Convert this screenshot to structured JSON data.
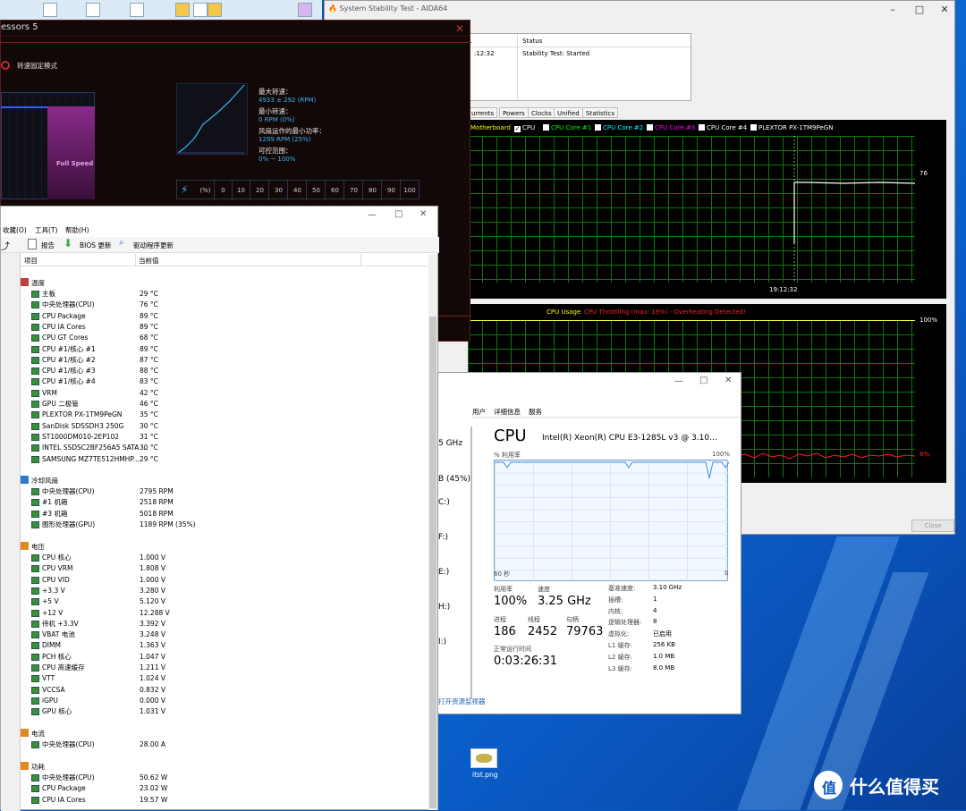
{
  "fan_tool": {
    "title": "essors 5",
    "mode_label": "转速固定模式",
    "full_speed": "Full Speed",
    "max_label": "最大转速：",
    "max_value": "4933 ± 292 (RPM)",
    "min_label": "最小转速：",
    "min_value": "0 RPM (0%)",
    "min_power_label": "风扇运作的最小功率：",
    "min_power_value": "1299 RPM (25%)",
    "range_label": "可控范围：",
    "range_value": "0% ~ 100%",
    "speed_header": [
      "(%)",
      "0",
      "10",
      "20",
      "30",
      "40",
      "50",
      "60",
      "70",
      "80",
      "90",
      "100"
    ]
  },
  "stability": {
    "title": "System Stability Test - AIDA64",
    "table_headers": [
      "",
      "Status"
    ],
    "table_row": {
      "time": ":12:32",
      "status": "Stability Test: Started"
    },
    "tabs": [
      "urrents",
      "Powers",
      "Clocks",
      "Unified",
      "Statistics"
    ],
    "legend": [
      {
        "label": "Motherboard",
        "color": "#ffff00",
        "checked": false
      },
      {
        "label": "CPU",
        "color": "#ffffff",
        "checked": true
      },
      {
        "label": "CPU Core #1",
        "color": "#00ff00",
        "checked": false
      },
      {
        "label": "CPU Core #2",
        "color": "#00ffff",
        "checked": false
      },
      {
        "label": "CPU Core #3",
        "color": "#ff00ff",
        "checked": false
      },
      {
        "label": "CPU Core #4",
        "color": "#ffffff",
        "checked": false
      },
      {
        "label": "PLEXTOR PX-1TM9PeGN",
        "color": "#ffffff",
        "checked": false
      }
    ],
    "temp_value": "76",
    "time_label": "19:12:32",
    "usage_label": "CPU Usage",
    "throttle_label": "CPU Throttling (max: 19%) - Overheating Detected!",
    "usage_max": "100%",
    "usage_val": "8%",
    "close_label": "Close"
  },
  "sensors": {
    "menu": [
      "收藏(O)",
      "工具(T)",
      "帮助(H)"
    ],
    "toolbar": {
      "report": "报告",
      "bios": "BIOS 更新",
      "driver": "驱动程序更新"
    },
    "col_item": "项目",
    "col_value": "当前值",
    "temperature": {
      "title": "温度",
      "rows": [
        [
          "主板",
          "29 °C"
        ],
        [
          "中央处理器(CPU)",
          "76 °C"
        ],
        [
          "CPU Package",
          "89 °C"
        ],
        [
          "CPU IA Cores",
          "89 °C"
        ],
        [
          "CPU GT Cores",
          "68 °C"
        ],
        [
          "CPU #1/核心 #1",
          "89 °C"
        ],
        [
          "CPU #1/核心 #2",
          "87 °C"
        ],
        [
          "CPU #1/核心 #3",
          "88 °C"
        ],
        [
          "CPU #1/核心 #4",
          "83 °C"
        ],
        [
          "VRM",
          "42 °C"
        ],
        [
          "GPU 二极管",
          "46 °C"
        ],
        [
          "PLEXTOR PX-1TM9PeGN",
          "35 °C"
        ],
        [
          "SanDisk SDSSDH3 250G",
          "30 °C"
        ],
        [
          "ST1000DM010-2EP102",
          "31 °C"
        ],
        [
          "INTEL SSDSC2BF256A5 SATA ...",
          "30 °C"
        ],
        [
          "SAMSUNG MZ7TE512HMHP...",
          "29 °C"
        ]
      ]
    },
    "fans": {
      "title": "冷却风扇",
      "rows": [
        [
          "中央处理器(CPU)",
          "2795 RPM"
        ],
        [
          "#1 机箱",
          "2518 RPM"
        ],
        [
          "#3 机箱",
          "5018 RPM"
        ],
        [
          "图形处理器(GPU)",
          "1189 RPM  (35%)"
        ]
      ]
    },
    "voltage": {
      "title": "电压",
      "rows": [
        [
          "CPU 核心",
          "1.000 V"
        ],
        [
          "CPU VRM",
          "1.808 V"
        ],
        [
          "CPU VID",
          "1.000 V"
        ],
        [
          "+3.3 V",
          "3.280 V"
        ],
        [
          "+5 V",
          "5.120 V"
        ],
        [
          "+12 V",
          "12.288 V"
        ],
        [
          "待机 +3.3V",
          "3.392 V"
        ],
        [
          "VBAT 电池",
          "3.248 V"
        ],
        [
          "DIMM",
          "1.363 V"
        ],
        [
          "PCH 核心",
          "1.047 V"
        ],
        [
          "CPU 高速缓存",
          "1.211 V"
        ],
        [
          "VTT",
          "1.024 V"
        ],
        [
          "VCCSA",
          "0.832 V"
        ],
        [
          "iGPU",
          "0.000 V"
        ],
        [
          "GPU 核心",
          "1.031 V"
        ]
      ]
    },
    "current": {
      "title": "电流",
      "rows": [
        [
          "中央处理器(CPU)",
          "28.00 A"
        ]
      ]
    },
    "power": {
      "title": "功耗",
      "rows": [
        [
          "中央处理器(CPU)",
          "50.62 W"
        ],
        [
          "CPU Package",
          "23.02 W"
        ],
        [
          "CPU IA Cores",
          "19.57 W"
        ]
      ]
    }
  },
  "taskmgr": {
    "tabs": [
      "用户",
      "详细信息",
      "服务"
    ],
    "cpu_title": "CPU",
    "cpu_name": "Intel(R) Xeon(R) CPU E3-1285L v3 @ 3.10...",
    "util_label": "% 利用率",
    "max_label": "100%",
    "time_left": "60 秒",
    "time_right": "0",
    "left_items": [
      "5 GHz",
      "B (45%)",
      "C:)",
      "F:)",
      "E:)",
      "H:)",
      "I:)"
    ],
    "utilization_label": "利用率",
    "utilization": "100%",
    "speed_label": "速度",
    "speed": "3.25 GHz",
    "process_label": "进程",
    "processes": "186",
    "thread_label": "线程",
    "threads": "2452",
    "handle_label": "句柄",
    "handles": "79763",
    "uptime_label": "正常运行时间",
    "uptime": "0:03:26:31",
    "specs": [
      [
        "基准速度:",
        "3.10 GHz"
      ],
      [
        "插槽:",
        "1"
      ],
      [
        "内核:",
        "4"
      ],
      [
        "逻辑处理器:",
        "8"
      ],
      [
        "虚拟化:",
        "已启用"
      ],
      [
        "L1 缓存:",
        "256 KB"
      ],
      [
        "L2 缓存:",
        "1.0 MB"
      ],
      [
        "L3 缓存:",
        "8.0 MB"
      ]
    ],
    "resource_monitor": "打开资源监视器"
  },
  "desktop": {
    "file_label": "itst.png",
    "watermark": "什么值得买"
  }
}
